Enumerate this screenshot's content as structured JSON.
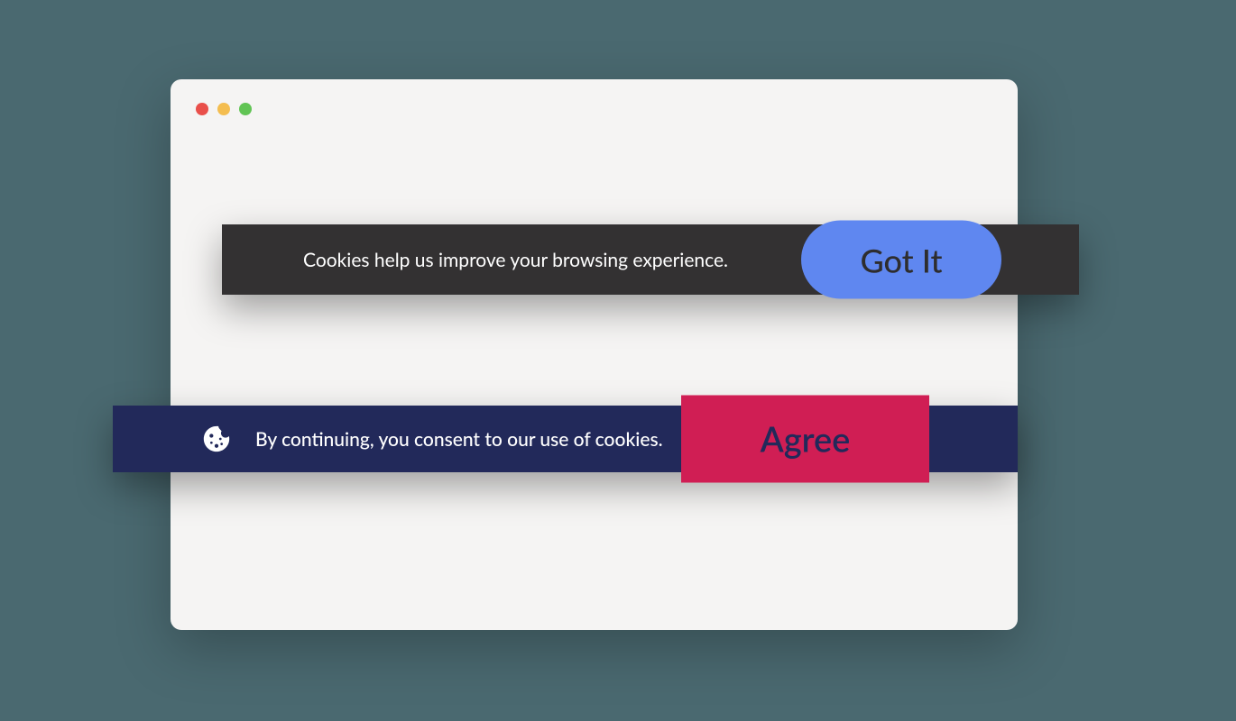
{
  "banner1": {
    "message": "Cookies help us improve your browsing experience.",
    "button_label": "Got It"
  },
  "banner2": {
    "message": "By continuing, you consent to our use of cookies.",
    "button_label": "Agree"
  },
  "colors": {
    "background": "#4a6970",
    "window_bg": "#f5f4f3",
    "banner1_bg": "#333132",
    "banner1_button": "#5f87f0",
    "banner2_bg": "#22295a",
    "banner2_button": "#d01e54"
  }
}
